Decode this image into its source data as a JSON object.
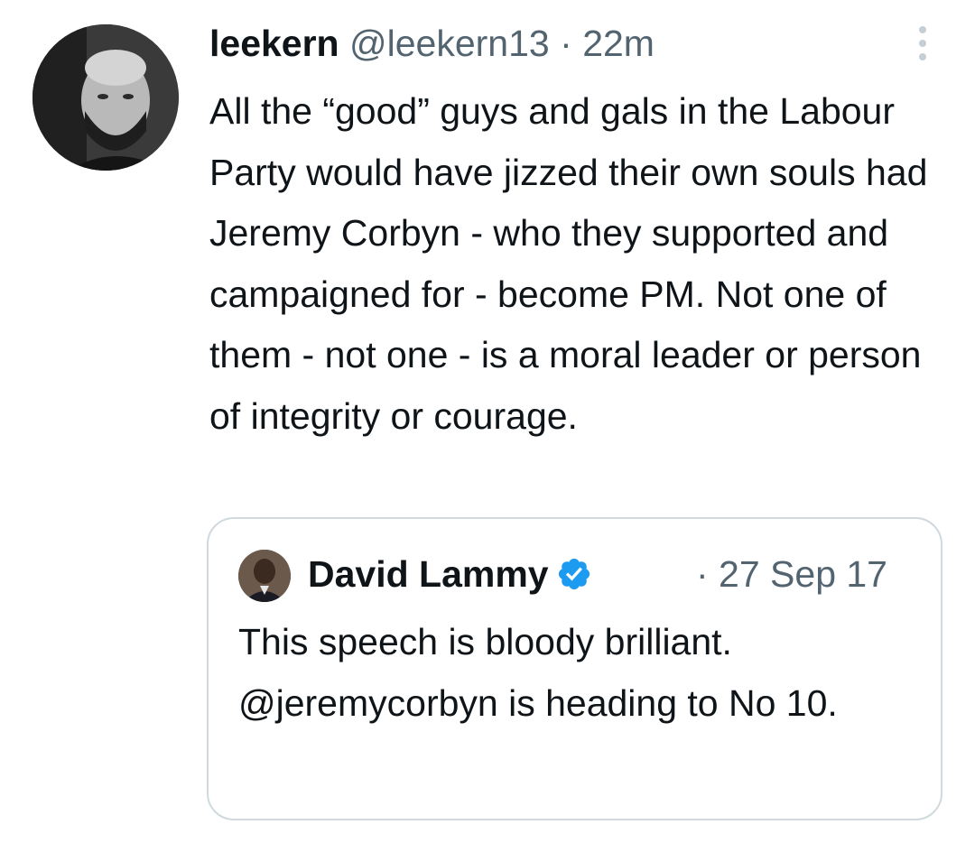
{
  "tweet": {
    "author_name": "leekern",
    "author_handle": "@leekern13",
    "separator": "·",
    "timestamp": "22m",
    "avatar_icon": "profile-photo-man-beard",
    "more_icon": "vertical-ellipsis-icon",
    "text": "All the “good” guys and gals in the Labour Party would have jizzed their own souls had Jeremy Corbyn - who they supported and campaigned for - become PM. Not one of them - not one - is a moral leader or person of integrity or courage."
  },
  "quoted_tweet": {
    "author_name": "David Lammy",
    "verified_icon": "verified-badge-icon",
    "verified_color": "#1d9bf0",
    "timestamp": "· 27 Sep 17",
    "text": "This speech is bloody brilliant. @jeremycorbyn is heading to No 10."
  },
  "colors": {
    "text_primary": "#0f1419",
    "text_secondary": "#536471",
    "border": "#cfd9de"
  }
}
